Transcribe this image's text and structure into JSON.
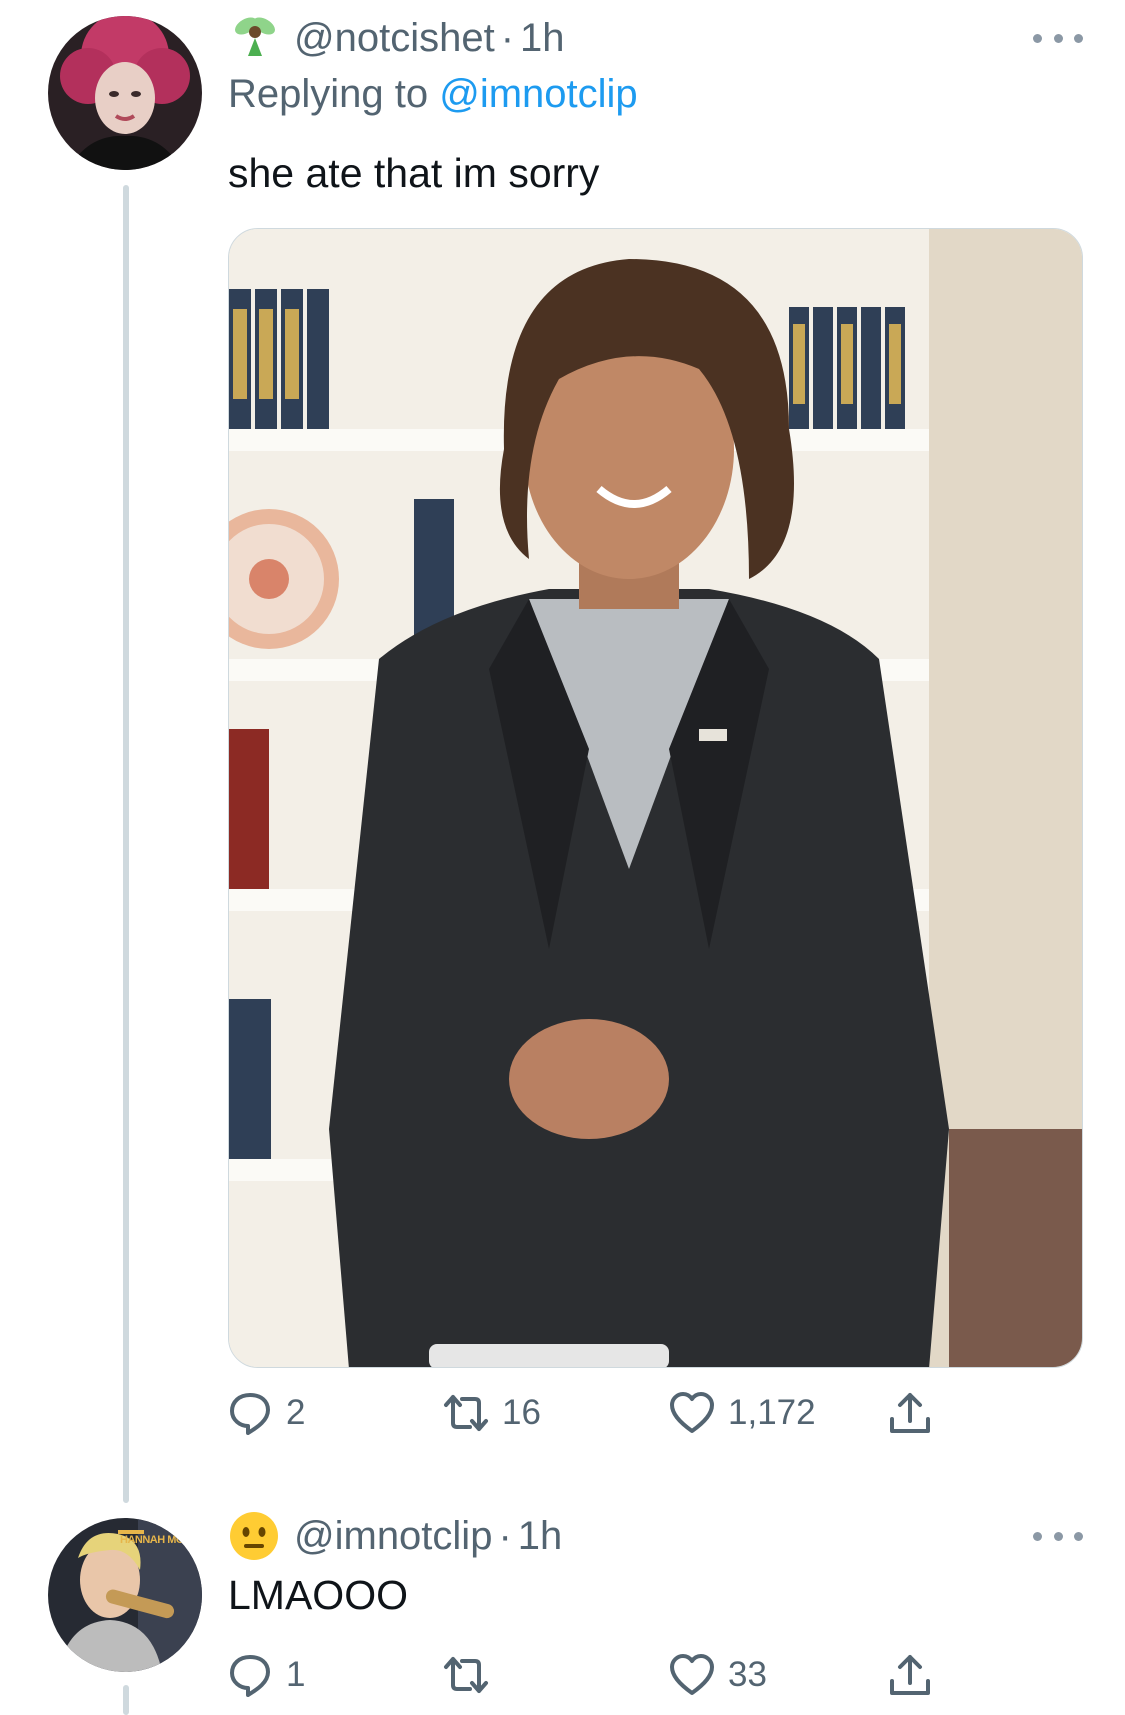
{
  "tweets": [
    {
      "handle": "@notcishet",
      "separator": "·",
      "time": "1h",
      "replying_prefix": "Replying to ",
      "replying_to": "@imnotclip",
      "text": "she ate that im sorry",
      "actions": {
        "replies": "2",
        "retweets": "16",
        "likes": "1,172"
      }
    },
    {
      "handle": "@imnotclip",
      "separator": "·",
      "time": "1h",
      "text": "LMAOOO",
      "actions": {
        "replies": "1",
        "retweets": "",
        "likes": "33"
      }
    }
  ],
  "avatar_1_text": "",
  "avatar_2_text": "HANNAH MONTANA",
  "icons": {
    "handle_emoji_1": "fairy-emoji",
    "handle_emoji_2": "neutral-face-emoji",
    "reply": "reply-icon",
    "retweet": "retweet-icon",
    "like": "heart-icon",
    "share": "share-icon",
    "more": "more-icon"
  },
  "colors": {
    "text": "#0f1419",
    "secondary": "#536471",
    "link": "#1d9bf0",
    "thread_line": "#cfd9de"
  }
}
